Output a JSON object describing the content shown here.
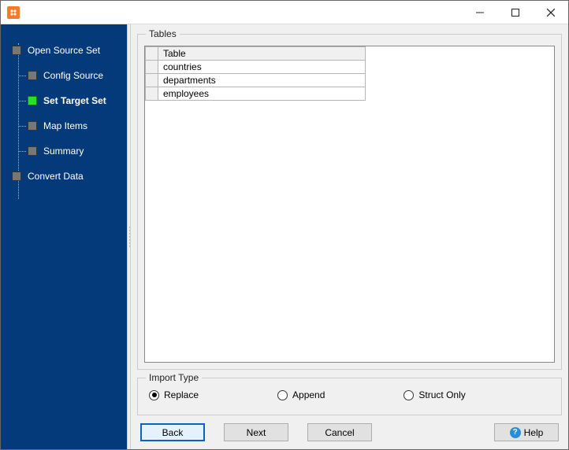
{
  "sidebar": {
    "steps": [
      {
        "label": "Open Source Set",
        "type": "root",
        "active": false
      },
      {
        "label": "Config Source",
        "type": "child",
        "active": false
      },
      {
        "label": "Set Target Set",
        "type": "child",
        "active": true
      },
      {
        "label": "Map Items",
        "type": "child",
        "active": false
      },
      {
        "label": "Summary",
        "type": "child",
        "active": false
      },
      {
        "label": "Convert Data",
        "type": "root2",
        "active": false
      }
    ]
  },
  "tables_group": {
    "legend": "Tables",
    "column_header": "Table",
    "rows": [
      "countries",
      "departments",
      "employees"
    ]
  },
  "import_type": {
    "legend": "Import Type",
    "options": [
      {
        "label": "Replace",
        "checked": true
      },
      {
        "label": "Append",
        "checked": false
      },
      {
        "label": "Struct Only",
        "checked": false
      }
    ]
  },
  "buttons": {
    "back": "Back",
    "next": "Next",
    "cancel": "Cancel",
    "help": "Help"
  }
}
